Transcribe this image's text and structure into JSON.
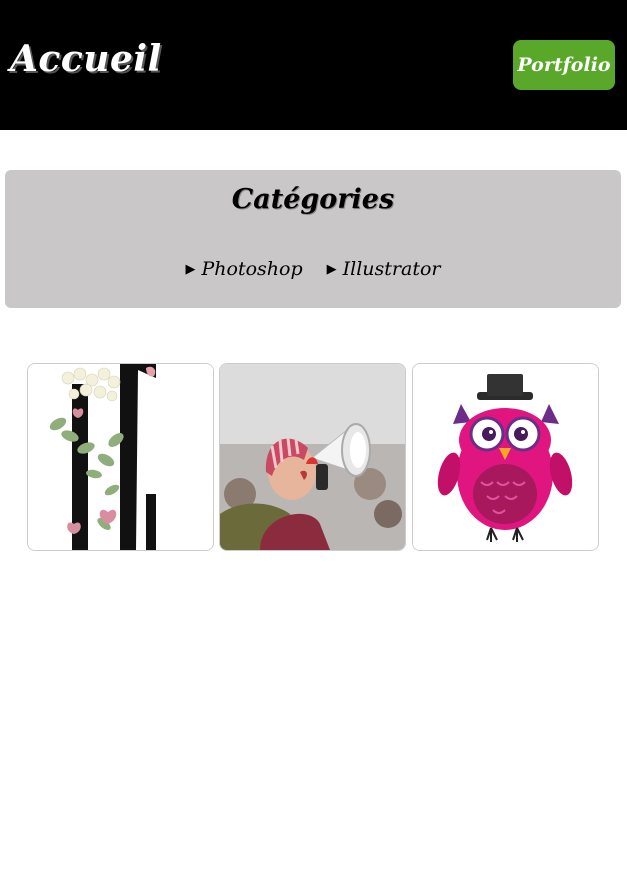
{
  "header": {
    "logo_text": "Accueil",
    "portfolio_label": "Portfolio"
  },
  "categories": {
    "title": "Catégories",
    "links": [
      {
        "label": "Photoshop"
      },
      {
        "label": "Illustrator"
      }
    ]
  },
  "gallery": {
    "items": [
      {
        "subject": "floral-letter-c-image"
      },
      {
        "subject": "woman-with-megaphone-photo"
      },
      {
        "subject": "pink-owl-top-hat-illustration"
      }
    ]
  },
  "colors": {
    "header_bg": "#000000",
    "accent_green": "#5aa82a",
    "panel_gray": "#c9c7c8"
  }
}
